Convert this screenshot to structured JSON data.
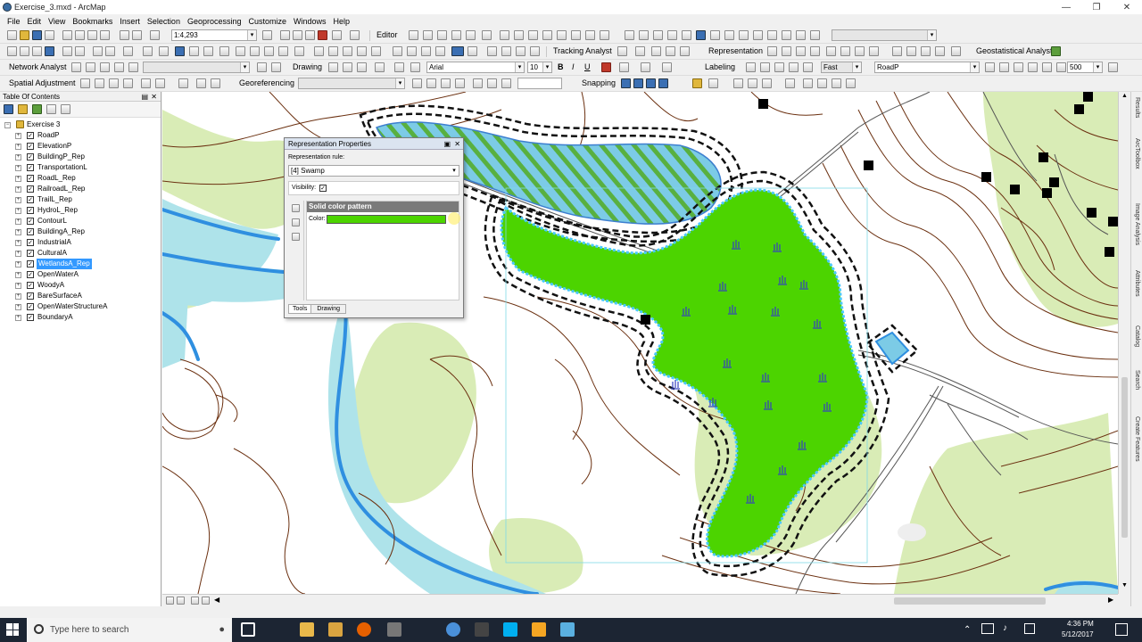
{
  "window": {
    "title": "Exercise_3.mxd - ArcMap"
  },
  "menu": [
    "File",
    "Edit",
    "View",
    "Bookmarks",
    "Insert",
    "Selection",
    "Geoprocessing",
    "Customize",
    "Windows",
    "Help"
  ],
  "toolbar1": {
    "scale": "1:4,293",
    "editor_label": "Editor"
  },
  "toolbar2": {
    "tracking_analyst": "Tracking Analyst",
    "representation": "Representation",
    "geostatistical_analyst": "Geostatistical Analyst"
  },
  "toolbar3": {
    "network_analyst": "Network Analyst",
    "drawing_label": "Drawing",
    "font": "Arial",
    "font_size": "10",
    "labeling_label": "Labeling",
    "label_speed": "Fast",
    "layer_combo": "RoadP",
    "pct_value": "500"
  },
  "toolbar4": {
    "spatial_adjustment": "Spatial Adjustment",
    "georeferencing": "Georeferencing",
    "snapping": "Snapping"
  },
  "toc": {
    "title": "Table Of Contents",
    "frame": "Exercise 3",
    "layers": [
      "RoadP",
      "ElevationP",
      "BuildingP_Rep",
      "TransportationL",
      "RoadL_Rep",
      "RailroadL_Rep",
      "TrailL_Rep",
      "HydroL_Rep",
      "ContourL",
      "BuildingA_Rep",
      "IndustrialA",
      "CulturalA",
      "WetlandsA_Rep",
      "OpenWaterA",
      "WoodyA",
      "BareSurfaceA",
      "OpenWaterStructureA",
      "BoundaryA"
    ],
    "selected": "WetlandsA_Rep"
  },
  "dialog": {
    "title": "Representation Properties",
    "rule_label": "Representation rule:",
    "rule_value": "[4] Swamp",
    "visibility_label": "Visibility:",
    "pattern_header": "Solid color pattern",
    "color_label": "Color:",
    "swatch_color": "#4cd400",
    "tab_tools": "Tools",
    "tab_drawing": "Drawing"
  },
  "right_dock": [
    "Results",
    "ArcToolbox",
    "Image Analysis",
    "Attributes",
    "Catalog",
    "Search",
    "Create Features"
  ],
  "taskbar": {
    "search_placeholder": "Type here to search",
    "time": "4:36 PM",
    "date": "5/12/2017"
  },
  "colors": {
    "wetland_green": "#4cd400",
    "water_blue": "#aee3ea",
    "river_blue": "#2f8fe0",
    "woody_green": "#d9ecb6",
    "contour_brown": "#6b3010"
  }
}
